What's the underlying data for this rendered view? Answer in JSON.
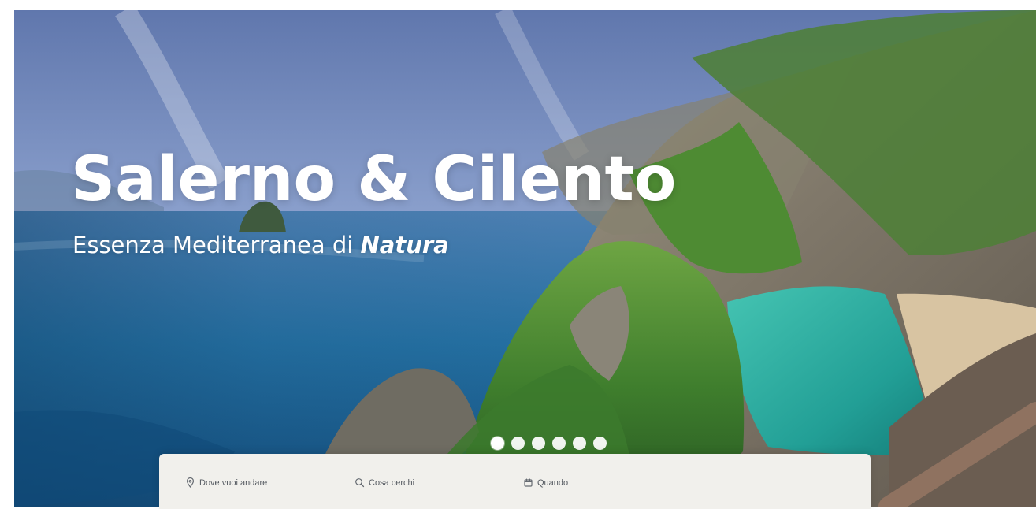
{
  "hero": {
    "title": "Salerno & Cilento",
    "subtitle_prefix": "Essenza Mediterranea di ",
    "subtitle_emphasis": "Natura",
    "image_alt": "coastal-cove-photo"
  },
  "carousel": {
    "slide_count": 6,
    "active_index": 0
  },
  "search": {
    "where_label": "Dove vuoi andare",
    "where_icon": "map-pin-icon",
    "what_label": "Cosa cerchi",
    "what_icon": "search-icon",
    "when_label": "Quando",
    "when_icon": "calendar-icon"
  },
  "colors": {
    "title_text": "#ffffff",
    "panel_background": "#f1f0ec",
    "panel_text": "#555a61"
  }
}
